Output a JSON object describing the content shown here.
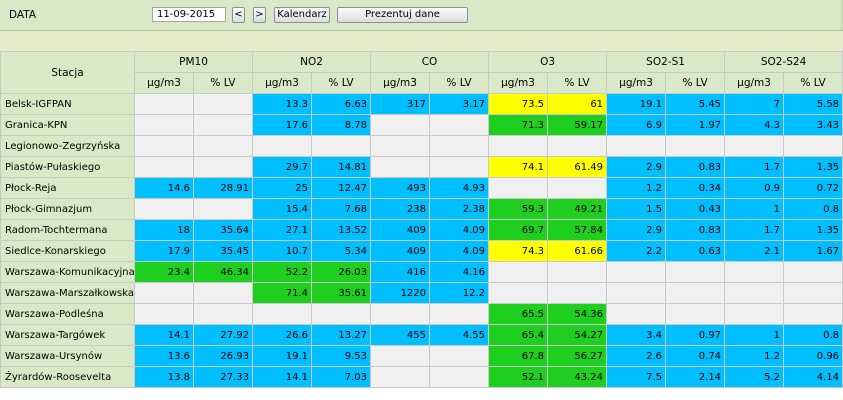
{
  "toolbar": {
    "date_label": "DATA",
    "date_value": "11-09-2015",
    "prev_label": "<",
    "next_label": ">",
    "calendar_label": "Kalendarz",
    "show_label": "Prezentuj dane"
  },
  "colors": {
    "blue": "#00bfff",
    "green": "#1fcf1f",
    "yellow": "#ffff00",
    "empty": "#f0f0f0",
    "header": "#d9e9c7"
  },
  "table": {
    "station_header": "Stacja",
    "pollutants": [
      "PM10",
      "NO2",
      "CO",
      "O3",
      "SO2-S1",
      "SO2-S24"
    ],
    "units": [
      "µg/m3",
      "% LV"
    ],
    "rows": [
      {
        "station": "Belsk-IGFPAN",
        "cells": [
          [
            "",
            ""
          ],
          [
            "13.3",
            "6.63"
          ],
          [
            "317",
            "3.17"
          ],
          [
            "73.5",
            "61"
          ],
          [
            "19.1",
            "5.45"
          ],
          [
            "7",
            "5.58"
          ]
        ],
        "colors": [
          "e",
          "e",
          "b",
          "b",
          "b",
          "b",
          "y",
          "y",
          "b",
          "b",
          "b",
          "b"
        ]
      },
      {
        "station": "Granica-KPN",
        "cells": [
          [
            "",
            ""
          ],
          [
            "17.6",
            "8.78"
          ],
          [
            "",
            ""
          ],
          [
            "71.3",
            "59.17"
          ],
          [
            "6.9",
            "1.97"
          ],
          [
            "4.3",
            "3.43"
          ]
        ],
        "colors": [
          "e",
          "e",
          "b",
          "b",
          "e",
          "e",
          "g",
          "g",
          "b",
          "b",
          "b",
          "b"
        ]
      },
      {
        "station": "Legionowo-Zegrzyńska",
        "cells": [
          [
            "",
            ""
          ],
          [
            "",
            ""
          ],
          [
            "",
            ""
          ],
          [
            "",
            ""
          ],
          [
            "",
            ""
          ],
          [
            "",
            ""
          ]
        ],
        "colors": [
          "e",
          "e",
          "e",
          "e",
          "e",
          "e",
          "e",
          "e",
          "e",
          "e",
          "e",
          "e"
        ]
      },
      {
        "station": "Piastów-Pułaskiego",
        "cells": [
          [
            "",
            ""
          ],
          [
            "29.7",
            "14.81"
          ],
          [
            "",
            ""
          ],
          [
            "74.1",
            "61.49"
          ],
          [
            "2.9",
            "0.83"
          ],
          [
            "1.7",
            "1.35"
          ]
        ],
        "colors": [
          "e",
          "e",
          "b",
          "b",
          "e",
          "e",
          "y",
          "y",
          "b",
          "b",
          "b",
          "b"
        ]
      },
      {
        "station": "Płock-Reja",
        "cells": [
          [
            "14.6",
            "28.91"
          ],
          [
            "25",
            "12.47"
          ],
          [
            "493",
            "4.93"
          ],
          [
            "",
            ""
          ],
          [
            "1.2",
            "0.34"
          ],
          [
            "0.9",
            "0.72"
          ]
        ],
        "colors": [
          "b",
          "b",
          "b",
          "b",
          "b",
          "b",
          "e",
          "e",
          "b",
          "b",
          "b",
          "b"
        ]
      },
      {
        "station": "Płock-Gimnazjum",
        "cells": [
          [
            "",
            ""
          ],
          [
            "15.4",
            "7.68"
          ],
          [
            "238",
            "2.38"
          ],
          [
            "59.3",
            "49.21"
          ],
          [
            "1.5",
            "0.43"
          ],
          [
            "1",
            "0.8"
          ]
        ],
        "colors": [
          "e",
          "e",
          "b",
          "b",
          "b",
          "b",
          "g",
          "g",
          "b",
          "b",
          "b",
          "b"
        ]
      },
      {
        "station": "Radom-Tochtermana",
        "cells": [
          [
            "18",
            "35.64"
          ],
          [
            "27.1",
            "13.52"
          ],
          [
            "409",
            "4.09"
          ],
          [
            "69.7",
            "57.84"
          ],
          [
            "2.9",
            "0.83"
          ],
          [
            "1.7",
            "1.35"
          ]
        ],
        "colors": [
          "b",
          "b",
          "b",
          "b",
          "b",
          "b",
          "g",
          "g",
          "b",
          "b",
          "b",
          "b"
        ]
      },
      {
        "station": "Siedlce-Konarskiego",
        "cells": [
          [
            "17.9",
            "35.45"
          ],
          [
            "10.7",
            "5.34"
          ],
          [
            "409",
            "4.09"
          ],
          [
            "74.3",
            "61.66"
          ],
          [
            "2.2",
            "0.63"
          ],
          [
            "2.1",
            "1.67"
          ]
        ],
        "colors": [
          "b",
          "b",
          "b",
          "b",
          "b",
          "b",
          "y",
          "y",
          "b",
          "b",
          "b",
          "b"
        ]
      },
      {
        "station": "Warszawa-Komunikacyjna",
        "cells": [
          [
            "23.4",
            "46.34"
          ],
          [
            "52.2",
            "26.03"
          ],
          [
            "416",
            "4.16"
          ],
          [
            "",
            ""
          ],
          [
            "",
            ""
          ],
          [
            "",
            ""
          ]
        ],
        "colors": [
          "g",
          "g",
          "g",
          "g",
          "b",
          "b",
          "e",
          "e",
          "e",
          "e",
          "e",
          "e"
        ]
      },
      {
        "station": "Warszawa-Marszałkowska",
        "cells": [
          [
            "",
            ""
          ],
          [
            "71.4",
            "35.61"
          ],
          [
            "1220",
            "12.2"
          ],
          [
            "",
            ""
          ],
          [
            "",
            ""
          ],
          [
            "",
            ""
          ]
        ],
        "colors": [
          "e",
          "e",
          "g",
          "g",
          "b",
          "b",
          "e",
          "e",
          "e",
          "e",
          "e",
          "e"
        ]
      },
      {
        "station": "Warszawa-Podleśna",
        "cells": [
          [
            "",
            ""
          ],
          [
            "",
            ""
          ],
          [
            "",
            ""
          ],
          [
            "65.5",
            "54.36"
          ],
          [
            "",
            ""
          ],
          [
            "",
            ""
          ]
        ],
        "colors": [
          "e",
          "e",
          "e",
          "e",
          "e",
          "e",
          "g",
          "g",
          "e",
          "e",
          "e",
          "e"
        ]
      },
      {
        "station": "Warszawa-Targówek",
        "cells": [
          [
            "14.1",
            "27.92"
          ],
          [
            "26.6",
            "13.27"
          ],
          [
            "455",
            "4.55"
          ],
          [
            "65.4",
            "54.27"
          ],
          [
            "3.4",
            "0.97"
          ],
          [
            "1",
            "0.8"
          ]
        ],
        "colors": [
          "b",
          "b",
          "b",
          "b",
          "b",
          "b",
          "g",
          "g",
          "b",
          "b",
          "b",
          "b"
        ]
      },
      {
        "station": "Warszawa-Ursynów",
        "cells": [
          [
            "13.6",
            "26.93"
          ],
          [
            "19.1",
            "9.53"
          ],
          [
            "",
            ""
          ],
          [
            "67.8",
            "56.27"
          ],
          [
            "2.6",
            "0.74"
          ],
          [
            "1.2",
            "0.96"
          ]
        ],
        "colors": [
          "b",
          "b",
          "b",
          "b",
          "e",
          "e",
          "g",
          "g",
          "b",
          "b",
          "b",
          "b"
        ]
      },
      {
        "station": "Żyrardów-Roosevelta",
        "cells": [
          [
            "13.8",
            "27.33"
          ],
          [
            "14.1",
            "7.03"
          ],
          [
            "",
            ""
          ],
          [
            "52.1",
            "43.24"
          ],
          [
            "7.5",
            "2.14"
          ],
          [
            "5.2",
            "4.14"
          ]
        ],
        "colors": [
          "b",
          "b",
          "b",
          "b",
          "e",
          "e",
          "g",
          "g",
          "b",
          "b",
          "b",
          "b"
        ]
      }
    ]
  }
}
